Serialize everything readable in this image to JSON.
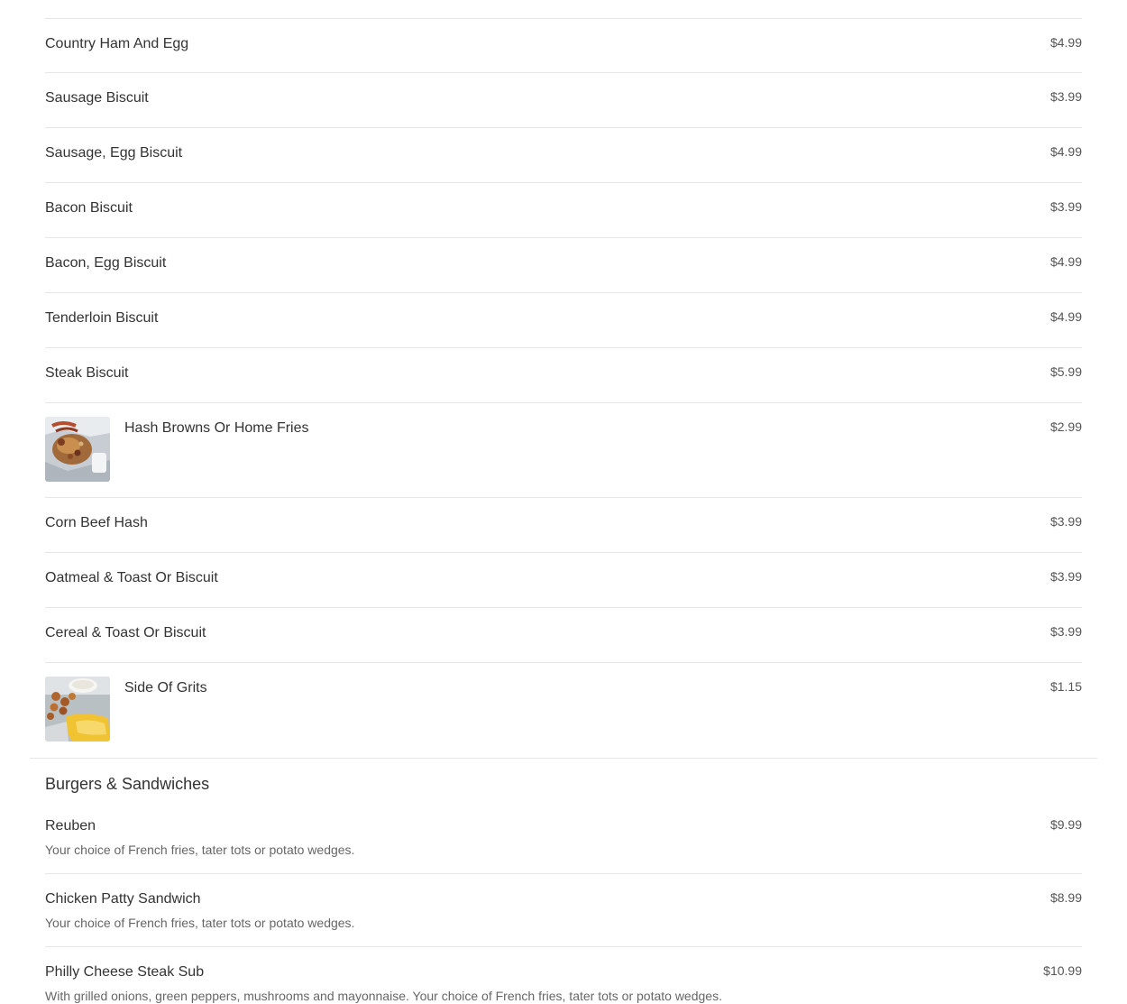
{
  "breakfast_items": [
    {
      "name": "Country Ham And Egg",
      "price": "$4.99"
    },
    {
      "name": "Sausage Biscuit",
      "price": "$3.99"
    },
    {
      "name": "Sausage, Egg Biscuit",
      "price": "$4.99"
    },
    {
      "name": "Bacon Biscuit",
      "price": "$3.99"
    },
    {
      "name": "Bacon, Egg Biscuit",
      "price": "$4.99"
    },
    {
      "name": "Tenderloin Biscuit",
      "price": "$4.99"
    },
    {
      "name": "Steak Biscuit",
      "price": "$5.99"
    },
    {
      "name": "Hash Browns Or Home Fries",
      "price": "$2.99",
      "thumb": "hash-browns-photo"
    },
    {
      "name": "Corn Beef Hash",
      "price": "$3.99"
    },
    {
      "name": "Oatmeal & Toast Or Biscuit",
      "price": "$3.99"
    },
    {
      "name": "Cereal & Toast Or Biscuit",
      "price": "$3.99"
    },
    {
      "name": "Side Of Grits",
      "price": "$1.15",
      "thumb": "side-of-grits-photo"
    }
  ],
  "burgers_section": {
    "title": "Burgers & Sandwiches",
    "items": [
      {
        "name": "Reuben",
        "price": "$9.99",
        "description": "Your choice of French fries, tater tots or potato wedges."
      },
      {
        "name": "Chicken Patty Sandwich",
        "price": "$8.99",
        "description": "Your choice of French fries, tater tots or potato wedges."
      },
      {
        "name": "Philly Cheese Steak Sub",
        "price": "$10.99",
        "description": "With grilled onions, green peppers, mushrooms and mayonnaise. Your choice of French fries, tater tots or potato wedges."
      }
    ]
  }
}
